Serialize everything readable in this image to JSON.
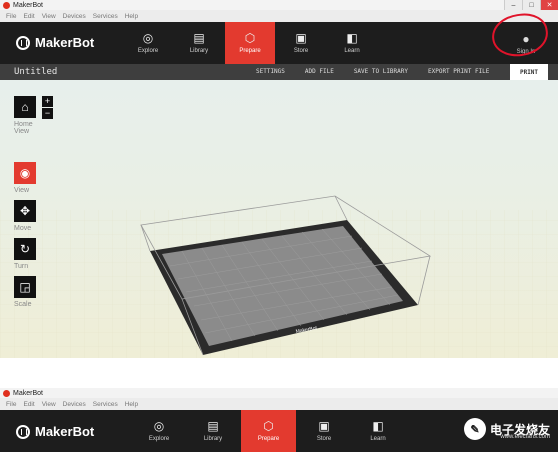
{
  "window1": {
    "title": "MakerBot",
    "menu": [
      "File",
      "Edit",
      "View",
      "Devices",
      "Services",
      "Help"
    ],
    "nav": {
      "logo": "MakerBot",
      "tabs": [
        {
          "label": "Explore",
          "icon": "compass-icon",
          "glyph": "◎"
        },
        {
          "label": "Library",
          "icon": "library-icon",
          "glyph": "▤"
        },
        {
          "label": "Prepare",
          "icon": "prepare-icon",
          "glyph": "⬡"
        },
        {
          "label": "Store",
          "icon": "store-icon",
          "glyph": "▣"
        },
        {
          "label": "Learn",
          "icon": "learn-icon",
          "glyph": "◧"
        }
      ],
      "active_tab": "Prepare",
      "signin_label": "Sign In"
    },
    "toolbar": {
      "doc_title": "Untitled",
      "links": [
        "SETTINGS",
        "ADD FILE",
        "SAVE TO LIBRARY",
        "EXPORT PRINT FILE"
      ],
      "print_label": "PRINT"
    },
    "tools": {
      "home_label": "Home View",
      "view_label": "View",
      "move_label": "Move",
      "turn_label": "Turn",
      "scale_label": "Scale"
    },
    "plate_label": "MakerBot"
  },
  "window2": {
    "title": "MakerBot",
    "menu": [
      "File",
      "Edit",
      "View",
      "Devices",
      "Services",
      "Help"
    ],
    "nav": {
      "logo": "MakerBot",
      "tabs": [
        {
          "label": "Explore",
          "glyph": "◎"
        },
        {
          "label": "Library",
          "glyph": "▤"
        },
        {
          "label": "Prepare",
          "glyph": "⬡"
        },
        {
          "label": "Store",
          "glyph": "▣"
        },
        {
          "label": "Learn",
          "glyph": "◧"
        }
      ]
    },
    "watermark": "电子发烧友",
    "watermark_sub": "www.elecfans.com"
  },
  "colors": {
    "accent": "#e33a2f",
    "nav_bg": "#1d1d1d",
    "annotation": "#e0132a"
  }
}
